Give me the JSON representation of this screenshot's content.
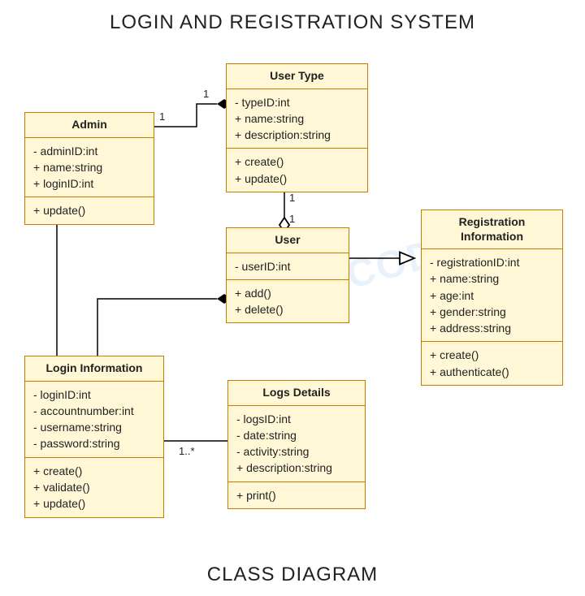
{
  "title": "LOGIN AND REGISTRATION SYSTEM",
  "subtitle": "CLASS DIAGRAM",
  "watermark": "RCECODE",
  "classes": {
    "admin": {
      "name": "Admin",
      "attrs": [
        "- adminID:int",
        "+ name:string",
        "+ loginID:int"
      ],
      "ops": [
        "+ update()"
      ]
    },
    "usertype": {
      "name": "User Type",
      "attrs": [
        "- typeID:int",
        "+ name:string",
        "+ description:string"
      ],
      "ops": [
        "+ create()",
        "+ update()"
      ]
    },
    "user": {
      "name": "User",
      "attrs": [
        "- userID:int"
      ],
      "ops": [
        "+ add()",
        "+ delete()"
      ]
    },
    "reginfo": {
      "name": "Registration Information",
      "attrs": [
        "- registrationID:int",
        "+ name:string",
        "+ age:int",
        "+ gender:string",
        "+ address:string"
      ],
      "ops": [
        "+ create()",
        "+ authenticate()"
      ]
    },
    "logininfo": {
      "name": "Login Information",
      "attrs": [
        "- loginID:int",
        "- accountnumber:int",
        "- username:string",
        "- password:string"
      ],
      "ops": [
        "+ create()",
        "+ validate()",
        "+ update()"
      ]
    },
    "logs": {
      "name": "Logs Details",
      "attrs": [
        "- logsID:int",
        "- date:string",
        "- activity:string",
        "+ description:string"
      ],
      "ops": [
        "+ print()"
      ]
    }
  },
  "multiplicities": {
    "admin_usertype_admin": "1",
    "admin_usertype_type": "1",
    "usertype_user_type": "1",
    "usertype_user_user": "1",
    "logininfo_logs": "1..*"
  }
}
